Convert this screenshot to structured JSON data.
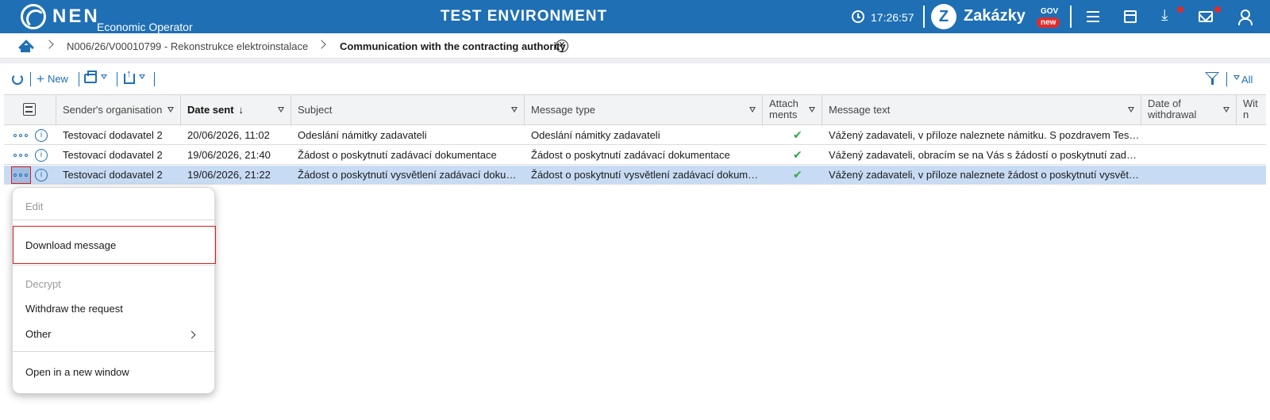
{
  "header": {
    "brand": "NEN",
    "brand_sub": "Economic Operator",
    "environment": "TEST ENVIRONMENT",
    "time": "17:26:57",
    "zakazky_logo": "Z",
    "zakazky_name": "Zakázky",
    "zakazky_gov": "GOV",
    "zakazky_new": "new",
    "icons": [
      "clock-icon",
      "menu-icon",
      "calendar-icon",
      "download-icon",
      "mail-icon",
      "user-icon"
    ],
    "accent_color": "#1f6fb5",
    "alert_color": "#e32b2b"
  },
  "breadcrumb": {
    "items": [
      "N006/26/V00010799 - Rekonstrukce elektroinstalace",
      "Communication with the contracting authority"
    ]
  },
  "toolbar": {
    "new_label": "New",
    "all_label": "All"
  },
  "table": {
    "columns": [
      {
        "label": "Sender's organisation"
      },
      {
        "label": "Date sent",
        "sorted": "descending"
      },
      {
        "label": "Subject"
      },
      {
        "label": "Message type"
      },
      {
        "label": "Attach ments"
      },
      {
        "label": "Message text"
      },
      {
        "label": "Date of withdrawal"
      },
      {
        "label": "Wit n"
      }
    ],
    "rows": [
      {
        "org": "Testovací dodavatel 2",
        "date": "20/06/2026, 11:02",
        "subject": "Odeslání námitky zadavateli",
        "type": "Odeslání námitky zadavateli",
        "attachment": "✔",
        "text": "Vážený zadavateli, v příloze naleznete námitku. S pozdravem Tes…",
        "withdrawal": "",
        "selected": false
      },
      {
        "org": "Testovací dodavatel 2",
        "date": "19/06/2026, 21:40",
        "subject": "Žádost o poskytnutí zadávací dokumentace",
        "type": "Žádost o poskytnutí zadávací dokumentace",
        "attachment": "✔",
        "text": "Vážený zadavateli, obracím se na Vás s žádostí o poskytnutí zad…",
        "withdrawal": "",
        "selected": false
      },
      {
        "org": "Testovací dodavatel 2",
        "date": "19/06/2026, 21:22",
        "subject": "Žádost o poskytnutí vysvětlení zadávací dokum…",
        "type": "Žádost o poskytnutí vysvětlení zadávací dokum…",
        "attachment": "✔",
        "text": "Vážený zadavateli, v příloze naleznete žádost o poskytnutí vysvět…",
        "withdrawal": "",
        "selected": true
      }
    ],
    "selected_color": "#c7dbf4",
    "check_color": "#2ea84a"
  },
  "context_menu": {
    "edit": "Edit",
    "download": "Download message",
    "decrypt": "Decrypt",
    "withdraw": "Withdraw the request",
    "other": "Other",
    "open_new": "Open in a new window"
  }
}
